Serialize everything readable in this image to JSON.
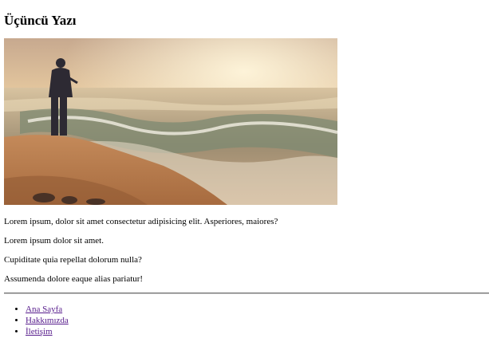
{
  "post": {
    "title": "Üçüncü Yazı",
    "paragraphs": [
      "Lorem ipsum, dolor sit amet consectetur adipisicing elit. Asperiores, maiores?",
      "Lorem ipsum dolor sit amet.",
      "Cupiditate quia repellat dolorum nulla?",
      "Assumenda dolore eaque alias pariatur!"
    ]
  },
  "nav": {
    "links": [
      {
        "label": "Ana Sayfa"
      },
      {
        "label": "Hakkımızda"
      },
      {
        "label": "İletişim"
      }
    ]
  },
  "colors": {
    "link": "#551a8b",
    "text": "#000000",
    "divider": "#6b6b6b"
  }
}
